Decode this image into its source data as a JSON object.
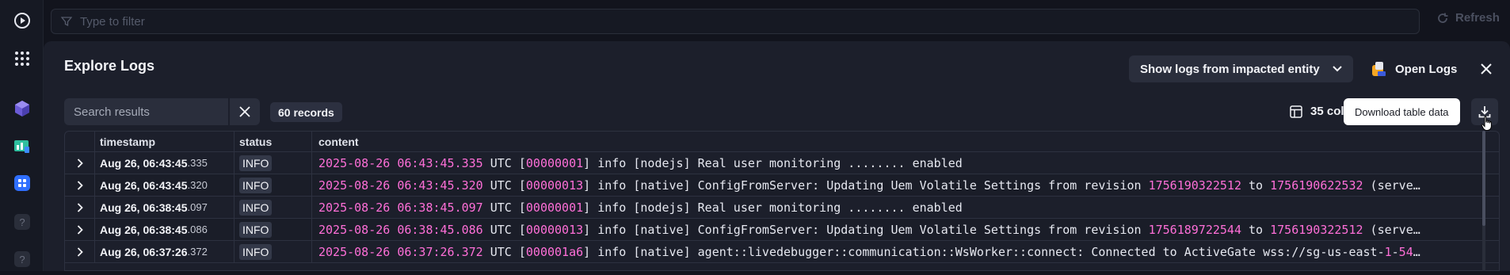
{
  "topbar": {
    "filter_placeholder": "Type to filter",
    "refresh_label": "Refresh"
  },
  "panel": {
    "title": "Explore Logs",
    "impact_button_label": "Show logs from impacted entity",
    "open_logs_label": "Open Logs",
    "search_placeholder": "Search results",
    "records_label": "60 records",
    "columns_label": "35 col",
    "tooltip_label": "Download table data"
  },
  "table": {
    "headers": [
      "timestamp",
      "status",
      "content"
    ],
    "rows": [
      {
        "date": "Aug 26, 06:43:45",
        "ms": ".335",
        "status": "INFO",
        "c": [
          "2025-08-26 06:43:45.335",
          " UTC [",
          "00000001",
          "] info [nodejs] Real user monitoring ........ enabled",
          "",
          "",
          "",
          ""
        ]
      },
      {
        "date": "Aug 26, 06:43:45",
        "ms": ".320",
        "status": "INFO",
        "c": [
          "2025-08-26 06:43:45.320",
          " UTC [",
          "00000013",
          "] info [native] ConfigFromServer: Updating Uem Volatile Settings from revision ",
          "1756190322512",
          " to ",
          "1756190622532",
          " (serve…"
        ]
      },
      {
        "date": "Aug 26, 06:38:45",
        "ms": ".097",
        "status": "INFO",
        "c": [
          "2025-08-26 06:38:45.097",
          " UTC [",
          "00000001",
          "] info [nodejs] Real user monitoring ........ enabled",
          "",
          "",
          "",
          ""
        ]
      },
      {
        "date": "Aug 26, 06:38:45",
        "ms": ".086",
        "status": "INFO",
        "c": [
          "2025-08-26 06:38:45.086",
          " UTC [",
          "00000013",
          "] info [native] ConfigFromServer: Updating Uem Volatile Settings from revision ",
          "1756189722544",
          " to ",
          "1756190322512",
          " (serve…"
        ]
      },
      {
        "date": "Aug 26, 06:37:26",
        "ms": ".372",
        "status": "INFO",
        "c": [
          "2025-08-26 06:37:26.372",
          " UTC [",
          "000001a6",
          "] info [native] agent::livedebugger::communication::WsWorker::connect: Connected to ActiveGate wss://sg-us-east-",
          "1",
          "-",
          "54",
          "…"
        ]
      }
    ]
  },
  "colors": {
    "accent_pink": "#ff6fd8",
    "panel_bg": "#1c1f2b"
  }
}
